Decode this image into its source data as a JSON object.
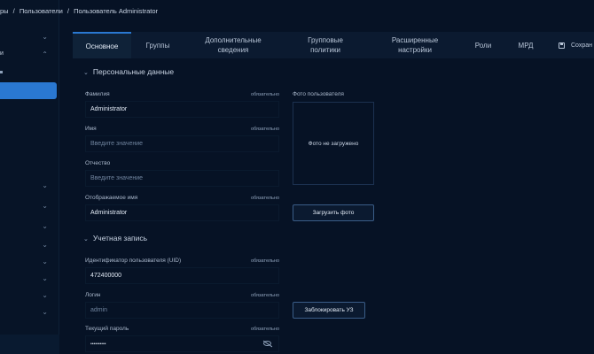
{
  "breadcrumb": {
    "items": [
      "ры",
      "/",
      "Пользователи",
      "/",
      "Пользователь Administrator"
    ]
  },
  "sidebar": {
    "partial_label": "и"
  },
  "tabs": [
    {
      "label": "Основное",
      "active": true
    },
    {
      "label": "Группы"
    },
    {
      "label": "Дополнительные сведения"
    },
    {
      "label": "Групповые политики"
    },
    {
      "label": "Расширенные настройки"
    },
    {
      "label": "Роли"
    },
    {
      "label": "МРД"
    },
    {
      "label": "Сохран"
    }
  ],
  "personal": {
    "title": "Персональные данные",
    "surname_label": "Фамилия",
    "surname_required": "обязательно",
    "surname_value": "Administrator",
    "name_label": "Имя",
    "name_required": "обязательно",
    "name_placeholder": "Введите значение",
    "patronymic_label": "Отчество",
    "patronymic_placeholder": "Введите значение",
    "display_label": "Отображаемое имя",
    "display_required": "обязательно",
    "display_value": "Administrator",
    "photo_label": "Фото пользователя",
    "photo_empty": "Фото не загружено",
    "upload_button": "Загрузить фото"
  },
  "account": {
    "title": "Учетная запись",
    "uid_label": "Идентификатор пользователя (UID)",
    "uid_required": "обязательно",
    "uid_value": "472400000",
    "login_label": "Логин",
    "login_required": "обязательно",
    "login_value": "admin",
    "password_label": "Текущий пароль",
    "password_required": "обязательно",
    "password_value": "••••••••••",
    "block_button": "Заблокировать УЗ"
  },
  "colors": {
    "background": "#061225",
    "panel": "#0b1a30",
    "accent": "#2a78d1"
  }
}
